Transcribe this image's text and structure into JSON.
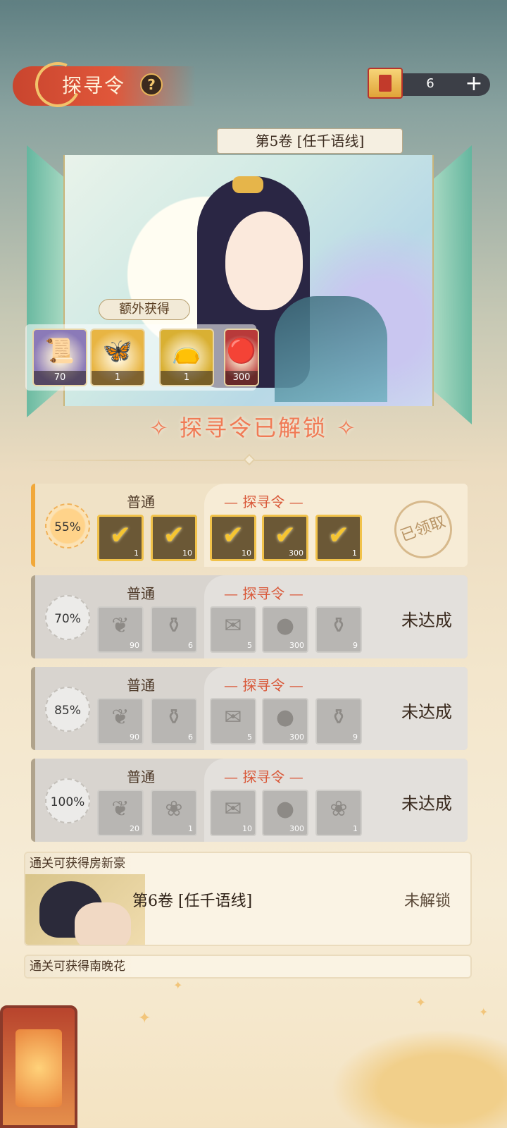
{
  "header": {
    "title": "探寻令",
    "help_icon": "?",
    "token_count": "6",
    "plus_icon": "+"
  },
  "volume": {
    "label": "第5卷  [任千语线]",
    "extra_label": "额外获得",
    "extra_rewards": [
      {
        "icon": "scroll-icon",
        "glyph": "📜",
        "qty": "70",
        "bg": "#8b7ab8"
      },
      {
        "icon": "butterfly-icon",
        "glyph": "🦋",
        "qty": "1",
        "bg": "#e8b543"
      },
      {
        "icon": "pouch-icon",
        "glyph": "👝",
        "qty": "1",
        "bg": "#d9b033"
      },
      {
        "icon": "orb-icon",
        "glyph": "🔴",
        "qty": "300",
        "bg": "#b83a3a"
      }
    ],
    "unlocked_text": "✧ 探寻令已解锁 ✧"
  },
  "milestones": [
    {
      "percent": "55%",
      "state": "active",
      "normal_label": "普通",
      "premium_label": "— 探寻令 —",
      "normal_items": [
        {
          "icon": "check-icon",
          "qty": "1"
        },
        {
          "icon": "check-icon",
          "qty": "10"
        }
      ],
      "premium_items": [
        {
          "icon": "check-icon",
          "qty": "10"
        },
        {
          "icon": "check-icon",
          "qty": "300"
        },
        {
          "icon": "check-icon",
          "qty": "1"
        }
      ],
      "status": "已领取"
    },
    {
      "percent": "70%",
      "state": "locked",
      "normal_label": "普通",
      "premium_label": "— 探寻令 —",
      "normal_items": [
        {
          "icon": "feather-bag-icon",
          "qty": "90"
        },
        {
          "icon": "gourd-icon",
          "qty": "6"
        }
      ],
      "premium_items": [
        {
          "icon": "scroll-icon",
          "qty": "5"
        },
        {
          "icon": "orb-icon",
          "qty": "300"
        },
        {
          "icon": "gourd-icon",
          "qty": "9"
        }
      ],
      "status": "未达成"
    },
    {
      "percent": "85%",
      "state": "locked",
      "normal_label": "普通",
      "premium_label": "— 探寻令 —",
      "normal_items": [
        {
          "icon": "feather-bag-icon",
          "qty": "90"
        },
        {
          "icon": "gourd-icon",
          "qty": "6"
        }
      ],
      "premium_items": [
        {
          "icon": "scroll-icon",
          "qty": "5"
        },
        {
          "icon": "orb-icon",
          "qty": "300"
        },
        {
          "icon": "gourd-icon",
          "qty": "9"
        }
      ],
      "status": "未达成"
    },
    {
      "percent": "100%",
      "state": "locked",
      "normal_label": "普通",
      "premium_label": "— 探寻令 —",
      "normal_items": [
        {
          "icon": "feather-bag-icon",
          "qty": "20"
        },
        {
          "icon": "pouch-icon",
          "qty": "1"
        }
      ],
      "premium_items": [
        {
          "icon": "scroll-icon",
          "qty": "10"
        },
        {
          "icon": "orb-icon",
          "qty": "300"
        },
        {
          "icon": "pouch-icon",
          "qty": "1"
        }
      ],
      "status": "未达成"
    }
  ],
  "chapters": [
    {
      "label": "通关可获得房新豪",
      "title": "第6卷  [任千语线]",
      "status": "未解锁"
    },
    {
      "label": "通关可获得南晚花",
      "title": "",
      "status": ""
    }
  ],
  "colors": {
    "accent_red": "#e0573a",
    "gold": "#f1c24a",
    "premium_text": "#d9593a"
  }
}
